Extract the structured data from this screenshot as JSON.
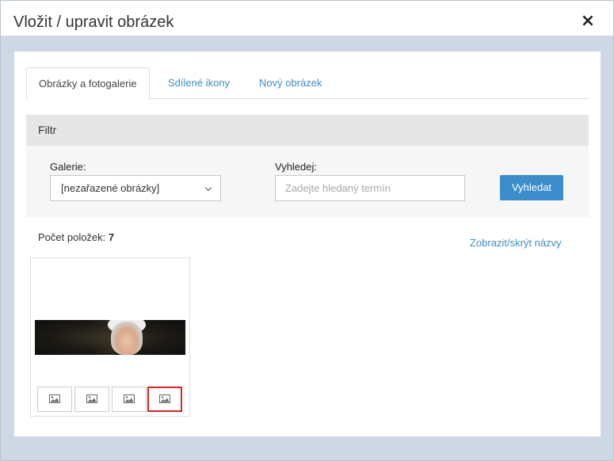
{
  "dialog": {
    "title": "Vložit / upravit obrázek",
    "close_icon": "×"
  },
  "tabs": [
    {
      "label": "Obrázky a fotogalerie",
      "active": true
    },
    {
      "label": "Sdílené ikony",
      "active": false
    },
    {
      "label": "Nový obrázek",
      "active": false
    }
  ],
  "filter": {
    "heading": "Filtr",
    "gallery_label": "Galerie:",
    "gallery_value": "[nezařazené obrázky]",
    "search_label": "Vyhledej:",
    "search_placeholder": "Zadejte hledaný termín",
    "search_value": "",
    "search_button": "Vyhledat"
  },
  "results": {
    "count_label": "Počet položek:",
    "count_value": "7",
    "toggle_names": "Zobrazit/skrýt názvy"
  },
  "image_card": {
    "thumbnail": "portrait-banner-image",
    "buttons": [
      {
        "icon": "image-icon",
        "highlighted": false
      },
      {
        "icon": "image-icon",
        "highlighted": false
      },
      {
        "icon": "image-icon",
        "highlighted": false
      },
      {
        "icon": "image-icon",
        "highlighted": true
      }
    ],
    "highlight_color": "#d9222a"
  },
  "colors": {
    "accent": "#3c8dcb",
    "link": "#3a8fc7",
    "backdrop": "#cdd8e4"
  }
}
